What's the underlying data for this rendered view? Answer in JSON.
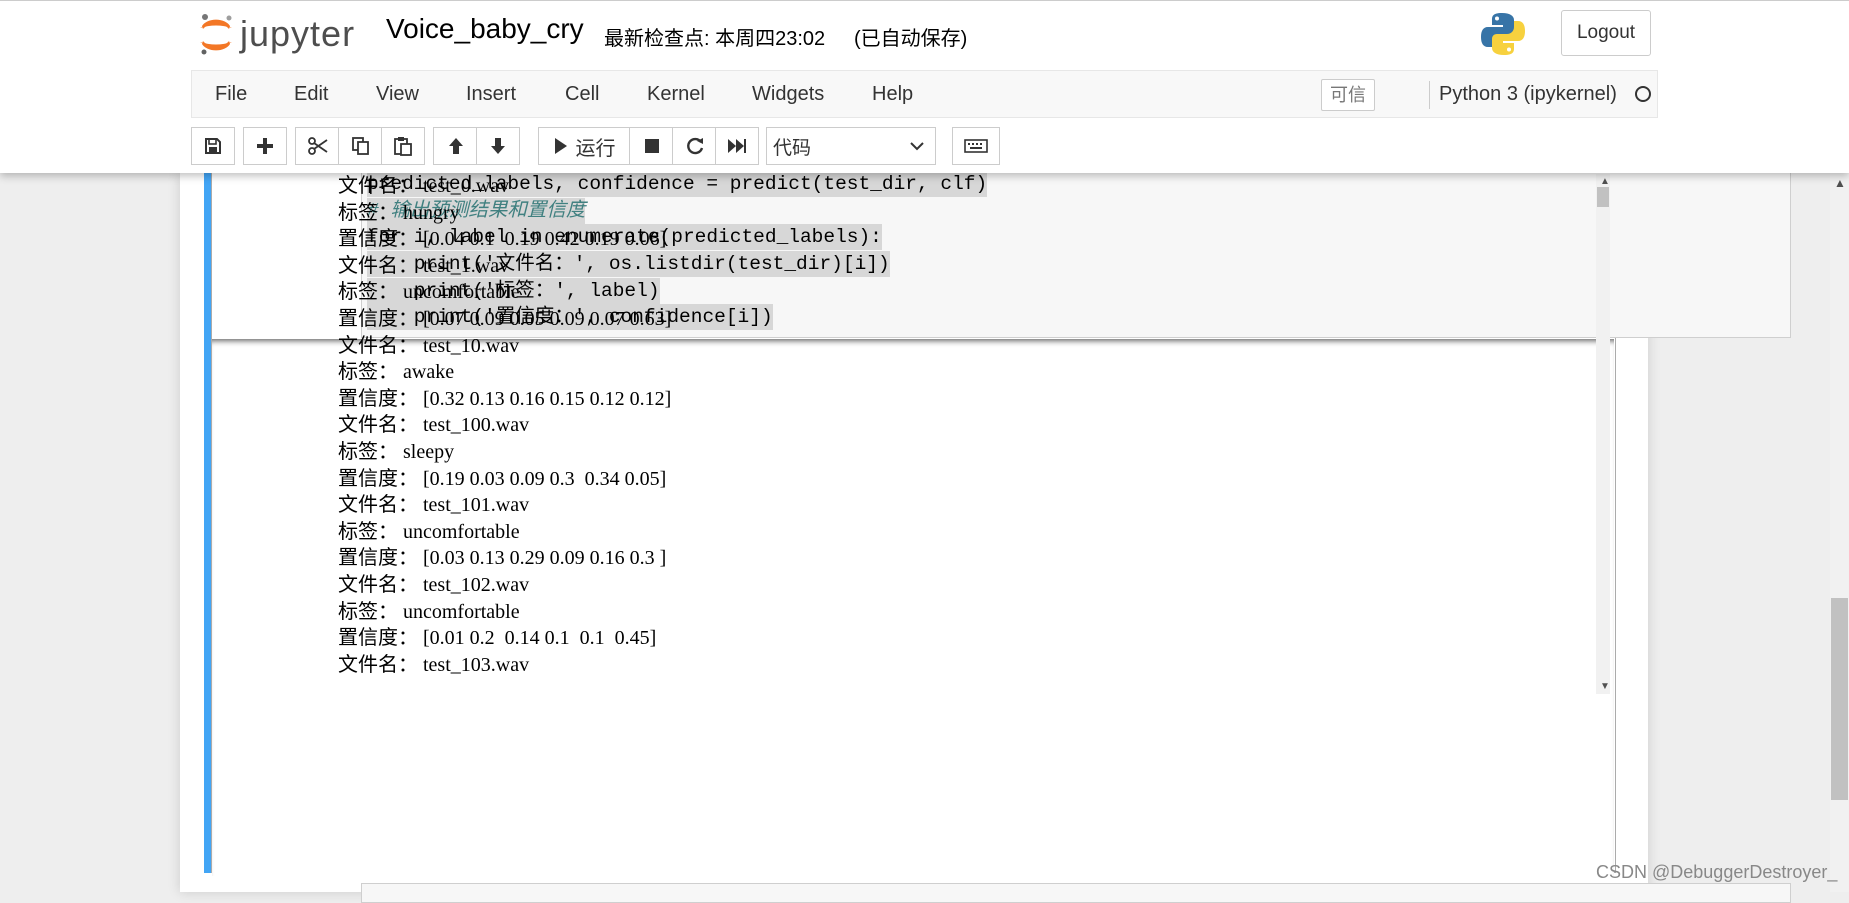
{
  "header": {
    "logo_text": "jupyter",
    "notebook_name": "Voice_baby_cry",
    "checkpoint": "最新检查点: 本周四23:02",
    "autosave": "(已自动保存)",
    "logout_label": "Logout"
  },
  "menu": {
    "items": [
      "File",
      "Edit",
      "View",
      "Insert",
      "Cell",
      "Kernel",
      "Widgets",
      "Help"
    ],
    "trusted": "可信",
    "kernel_name": "Python 3 (ipykernel)"
  },
  "toolbar": {
    "run_label": "运行",
    "cell_type": "代码"
  },
  "code_lines": [
    "predicted_labels, confidence = predict(test_dir, clf)",
    "# 输出预测结果和置信度",
    "for i, label in enumerate(predicted_labels):",
    "    print('文件名：', os.listdir(test_dir)[i])",
    "    print('标签：', label)",
    "    print('置信度：', confidence[i])"
  ],
  "output_lines": [
    "文件名： test_0.wav",
    "标签： hungry",
    "置信度： [0.04 0.1  0.19 0.42 0.19 0.06]",
    "文件名： test_1.wav",
    "标签： uncomfortable",
    "置信度： [0.07 0.09 0.05 0.09 0.07 0.63]",
    "文件名： test_10.wav",
    "标签： awake",
    "置信度： [0.32 0.13 0.16 0.15 0.12 0.12]",
    "文件名： test_100.wav",
    "标签： sleepy",
    "置信度： [0.19 0.03 0.09 0.3  0.34 0.05]",
    "文件名： test_101.wav",
    "标签： uncomfortable",
    "置信度： [0.03 0.13 0.29 0.09 0.16 0.3 ]",
    "文件名： test_102.wav",
    "标签： uncomfortable",
    "置信度： [0.01 0.2  0.14 0.1  0.1  0.45]",
    "文件名： test_103.wav"
  ],
  "watermark": "CSDN @DebuggerDestroyer_",
  "colors": {
    "cell_selected_bar": "#42a5f5",
    "keyword": "#008000",
    "string": "#ba2121",
    "comment": "#408080"
  },
  "icons": [
    "save-icon",
    "plus-icon",
    "scissors-icon",
    "copy-icon",
    "paste-icon",
    "arrow-up-icon",
    "arrow-down-icon",
    "play-icon",
    "stop-icon",
    "restart-icon",
    "fast-forward-icon",
    "keyboard-icon",
    "python-logo-icon"
  ]
}
